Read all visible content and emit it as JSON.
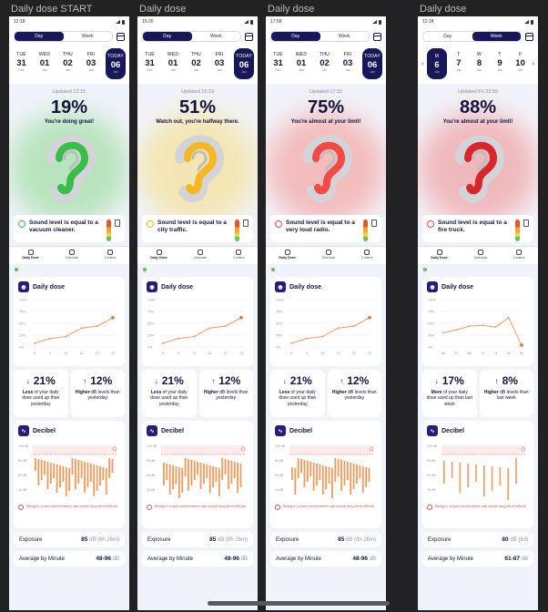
{
  "frames": [
    {
      "title": "Daily dose START",
      "time": "12:18",
      "tab_day": "Day",
      "tab_week": "Week",
      "active_tab": "day",
      "days": [
        {
          "wd": "TUE",
          "num": "31",
          "mo": "Dec"
        },
        {
          "wd": "WED",
          "num": "01",
          "mo": "Jan"
        },
        {
          "wd": "THU",
          "num": "02",
          "mo": "Jan"
        },
        {
          "wd": "FRI",
          "num": "03",
          "mo": "Jan"
        },
        {
          "wd": "TODAY",
          "num": "06",
          "mo": "Jan",
          "selected": true
        }
      ],
      "updated": "Updated 12:15",
      "percent": "19%",
      "message": "You're doing great!",
      "level_color": "#3bbd4a",
      "glow_color": "#8ad88d",
      "sound_text": "Sound level is equal to a vacuum cleaner.",
      "sound_icon_color": "#3bbd4a",
      "nav": [
        "Daily Dose",
        "Calendar",
        "Content"
      ],
      "daily_dose_title": "Daily dose",
      "dose_points": [
        8,
        18,
        22,
        40,
        44,
        62
      ],
      "dose_y_ticks": [
        "100%",
        "75%",
        "50%",
        "25%",
        "0%"
      ],
      "dose_x_ticks": [
        "8",
        "9",
        "10",
        "11",
        "12",
        "13"
      ],
      "stat1_value": "21%",
      "stat1_dir": "down",
      "stat1_label_bold": "Less",
      "stat1_label": "of your daily dose used up than yesterday",
      "stat2_value": "12%",
      "stat2_dir": "up",
      "stat2_label_bold": "Higher",
      "stat2_label": "dB levels than yesterday",
      "decibel_title": "Decibel",
      "decibel_y": [
        "100 dB",
        "80 dB",
        "60 dB",
        "40 dB"
      ],
      "warning": "Being in a loud environment can cause long-term effects.",
      "exposure_label": "Exposure",
      "exposure_value": "85",
      "exposure_unit": "dB (8h 26m)",
      "avg_label": "Average by Minute",
      "avg_value": "48-96",
      "avg_unit": "dB"
    },
    {
      "title": "Daily dose",
      "time": "15:20",
      "tab_day": "Day",
      "tab_week": "Week",
      "active_tab": "day",
      "days": [
        {
          "wd": "TUE",
          "num": "31",
          "mo": "Dec"
        },
        {
          "wd": "WED",
          "num": "01",
          "mo": "Jan"
        },
        {
          "wd": "THU",
          "num": "02",
          "mo": "Jan"
        },
        {
          "wd": "FRI",
          "num": "03",
          "mo": "Jan"
        },
        {
          "wd": "TODAY",
          "num": "06",
          "mo": "Jan",
          "selected": true
        }
      ],
      "updated": "Updated 15:19",
      "percent": "51%",
      "message": "Watch out, you're halfway there.",
      "level_color": "#f4b824",
      "glow_color": "#f6dc7c",
      "sound_text": "Sound level is equal to a city traffic.",
      "sound_icon_color": "#f4b824",
      "nav": [
        "Daily Dose",
        "Calendar",
        "Content"
      ],
      "daily_dose_title": "Daily dose",
      "dose_points": [
        8,
        18,
        22,
        40,
        44,
        62
      ],
      "dose_y_ticks": [
        "100%",
        "75%",
        "50%",
        "25%",
        "0%"
      ],
      "dose_x_ticks": [
        "8",
        "9",
        "10",
        "11",
        "12",
        "13"
      ],
      "stat1_value": "21%",
      "stat1_dir": "down",
      "stat1_label_bold": "Less",
      "stat1_label": "of your daily dose used up than yesterday",
      "stat2_value": "12%",
      "stat2_dir": "up",
      "stat2_label_bold": "Higher",
      "stat2_label": "dB levels than yesterday",
      "decibel_title": "Decibel",
      "decibel_y": [
        "100 dB",
        "80 dB",
        "60 dB",
        "40 dB"
      ],
      "warning": "Being in a loud environment can cause long-term effects.",
      "exposure_label": "Exposure",
      "exposure_value": "85",
      "exposure_unit": "dB (8h 26m)",
      "avg_label": "Average by Minute",
      "avg_value": "48-96",
      "avg_unit": "dB"
    },
    {
      "title": "Daily dose",
      "time": "17:58",
      "tab_day": "Day",
      "tab_week": "Week",
      "active_tab": "day",
      "days": [
        {
          "wd": "TUE",
          "num": "31",
          "mo": "Dec"
        },
        {
          "wd": "WED",
          "num": "01",
          "mo": "Jan"
        },
        {
          "wd": "THU",
          "num": "02",
          "mo": "Jan"
        },
        {
          "wd": "FRI",
          "num": "03",
          "mo": "Jan"
        },
        {
          "wd": "TODAY",
          "num": "06",
          "mo": "Jan",
          "selected": true
        }
      ],
      "updated": "Updated 17:32",
      "percent": "75%",
      "message": "You're almost at your limit!",
      "level_color": "#f24a45",
      "glow_color": "#f5908c",
      "sound_text": "Sound level is equal to a very loud radio.",
      "sound_icon_color": "#f24a45",
      "nav": [
        "Daily Dose",
        "Calendar",
        "Content"
      ],
      "daily_dose_title": "Daily dose",
      "dose_points": [
        8,
        18,
        22,
        40,
        44,
        62
      ],
      "dose_y_ticks": [
        "100%",
        "75%",
        "50%",
        "25%",
        "0%"
      ],
      "dose_x_ticks": [
        "8",
        "9",
        "10",
        "11",
        "12",
        "13"
      ],
      "stat1_value": "21%",
      "stat1_dir": "down",
      "stat1_label_bold": "Less",
      "stat1_label": "of your daily dose used up than yesterday",
      "stat2_value": "12%",
      "stat2_dir": "up",
      "stat2_label_bold": "Higher",
      "stat2_label": "dB levels than yesterday",
      "decibel_title": "Decibel",
      "decibel_y": [
        "100 dB",
        "80 dB",
        "60 dB",
        "40 dB"
      ],
      "warning": "Being in a loud environment can cause long-term effects.",
      "exposure_label": "Exposure",
      "exposure_value": "85",
      "exposure_unit": "dB (8h 26m)",
      "avg_label": "Average by Minute",
      "avg_value": "48-96",
      "avg_unit": "dB"
    },
    {
      "title": "Daily dose",
      "time": "12:18",
      "tab_day": "Day",
      "tab_week": "Week",
      "active_tab": "week",
      "days": [
        {
          "wd": "M",
          "num": "6",
          "mo": "Jan",
          "selected": true
        },
        {
          "wd": "T",
          "num": "7",
          "mo": "Jan"
        },
        {
          "wd": "W",
          "num": "8",
          "mo": "Jan"
        },
        {
          "wd": "T",
          "num": "9",
          "mo": "Jan"
        },
        {
          "wd": "F",
          "num": "10",
          "mo": "Jan"
        }
      ],
      "updated": "Updated Fri 23:59",
      "percent": "88%",
      "message": "You're almost at your limit!",
      "level_color": "#d8262a",
      "glow_color": "#ef8a8a",
      "sound_text": "Sound level is equal to a fire truck.",
      "sound_icon_color": "#f24a45",
      "nav": [
        "Daily Dose",
        "Calendar",
        "Content"
      ],
      "daily_dose_title": "Daily dose",
      "dose_points": [
        30,
        36,
        44,
        46,
        42,
        62,
        4
      ],
      "dose_y_ticks": [
        "100%",
        "75%",
        "50%",
        "25%",
        "0%"
      ],
      "dose_x_ticks": [
        "Mo",
        "Tu",
        "We",
        "Th",
        "Fr",
        "Sa",
        "Su"
      ],
      "stat1_value": "17%",
      "stat1_dir": "down",
      "stat1_label_bold": "More",
      "stat1_label": "of your daily dose used up than last week",
      "stat2_value": "8%",
      "stat2_dir": "up",
      "stat2_label_bold": "Higher",
      "stat2_label": "dB levels than last week",
      "decibel_title": "Decibel",
      "decibel_y": [
        "100 dB",
        "80 dB",
        "60 dB",
        "40 dB"
      ],
      "warning": "Being in a loud environment can cause long-term effects.",
      "exposure_label": "Exposure",
      "exposure_value": "80",
      "exposure_unit": "dB (6d)",
      "avg_label": "Average by Minute",
      "avg_value": "61-87",
      "avg_unit": "dB"
    }
  ]
}
